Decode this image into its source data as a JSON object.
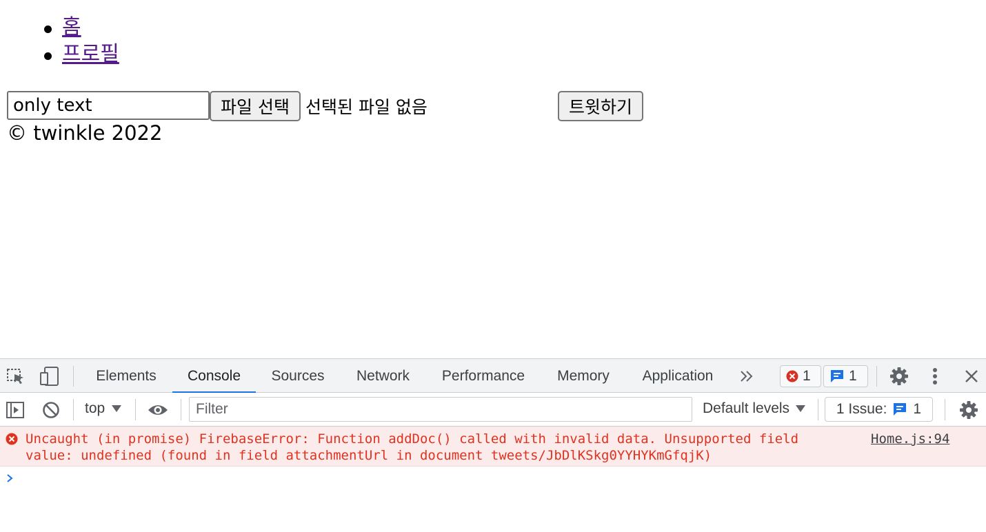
{
  "nav": {
    "items": [
      {
        "label": "홈"
      },
      {
        "label": "프로필"
      }
    ]
  },
  "tweet_form": {
    "text_value": "only text",
    "file_button_label": "파일 선택",
    "file_status": "선택된 파일 없음",
    "submit_label": "트윗하기"
  },
  "footer": {
    "text": "© twinkle 2022"
  },
  "devtools": {
    "tabs": [
      {
        "label": "Elements"
      },
      {
        "label": "Console"
      },
      {
        "label": "Sources"
      },
      {
        "label": "Network"
      },
      {
        "label": "Performance"
      },
      {
        "label": "Memory"
      },
      {
        "label": "Application"
      }
    ],
    "active_tab": "Console",
    "error_count": "1",
    "message_count": "1",
    "toolbar": {
      "context": "top",
      "filter_placeholder": "Filter",
      "levels": "Default levels",
      "issues_label": "1 Issue:",
      "issues_count": "1"
    },
    "error": {
      "line1": "Uncaught (in promise) FirebaseError: Function addDoc() called with invalid data. Unsupported field",
      "line2": "value: undefined (found in field attachmentUrl in document tweets/JbDlKSkg0YYHYKmGfqjK)",
      "source": "Home.js:94"
    },
    "colors": {
      "accent": "#1a73e8",
      "error_text": "#e0321f",
      "error_bg": "#fcebeb",
      "link_visited": "#551a8b"
    }
  }
}
